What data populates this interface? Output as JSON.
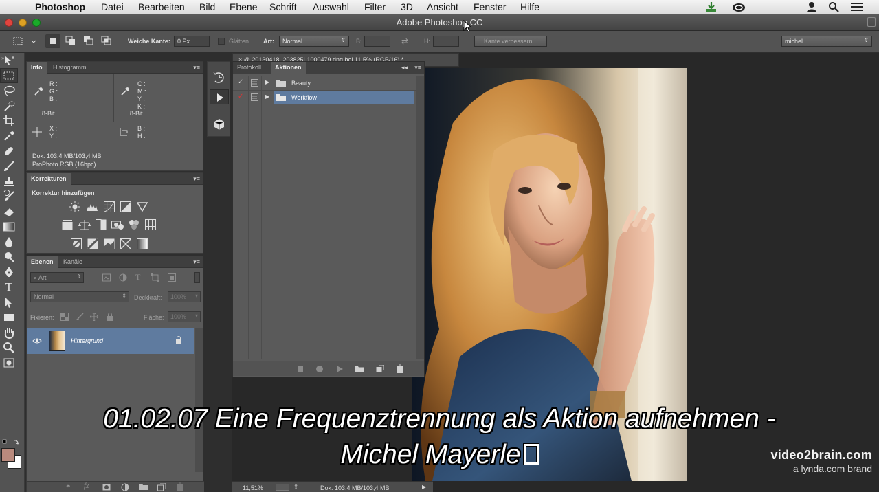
{
  "menubar": {
    "app": "Photoshop",
    "items": [
      "Datei",
      "Bearbeiten",
      "Bild",
      "Ebene",
      "Schrift",
      "Auswahl",
      "Filter",
      "3D",
      "Ansicht",
      "Fenster",
      "Hilfe"
    ]
  },
  "window": {
    "title": "Adobe Photoshop CC"
  },
  "options": {
    "feather_label": "Weiche Kante:",
    "feather_value": "0 Px",
    "smooth_label": "Glätten",
    "style_label": "Art:",
    "style_value": "Normal",
    "width_label": "B:",
    "height_label": "H:",
    "refine_button": "Kante verbessern...",
    "workspace": "michel"
  },
  "info_panel": {
    "tabs": [
      "Info",
      "Histogramm"
    ],
    "rgb_labels": "R :\nG :\nB :",
    "cmyk_labels": "C :\nM :\nY :\nK :",
    "bitdepth_left": "8-Bit",
    "bitdepth_right": "8-Bit",
    "xy_labels": "X :\nY :",
    "bh_labels": "B :\nH :",
    "doc_line": "Dok: 103,4 MB/103,4 MB",
    "profile_line": "ProPhoto RGB (16bpc)"
  },
  "adjustments_panel": {
    "tab": "Korrekturen",
    "heading": "Korrektur hinzufügen"
  },
  "layers_panel": {
    "tabs": [
      "Ebenen",
      "Kanäle"
    ],
    "filter_label": "Art",
    "blend_mode": "Normal",
    "opacity_label": "Deckkraft:",
    "opacity_value": "100%",
    "lock_label": "Fixieren:",
    "fill_label": "Fläche:",
    "fill_value": "100%",
    "layer_name": "Hintergrund"
  },
  "actions_panel": {
    "tabs": [
      "Protokoll",
      "Aktionen"
    ],
    "sets": [
      {
        "name": "Beauty",
        "selected": false
      },
      {
        "name": "Workflow",
        "selected": true
      }
    ]
  },
  "document": {
    "tab_label": "@ 20130418_203825L1000479.dng bei 11,5% (RGB/16) *",
    "zoom": "11,51%",
    "doc_size": "Dok: 103,4 MB/103,4 MB"
  },
  "subtitle": {
    "line1": "01.02.07 Eine Frequenztrennung als Aktion aufnehmen -",
    "line2": "Michel Mayerle"
  },
  "watermark": {
    "line1": "video2brain.com",
    "line2": "a lynda.com brand"
  },
  "colors": {
    "foreground_swatch": "#b98a7d",
    "background_swatch": "#ffffff",
    "selection_blue": "#5f7b9f"
  }
}
